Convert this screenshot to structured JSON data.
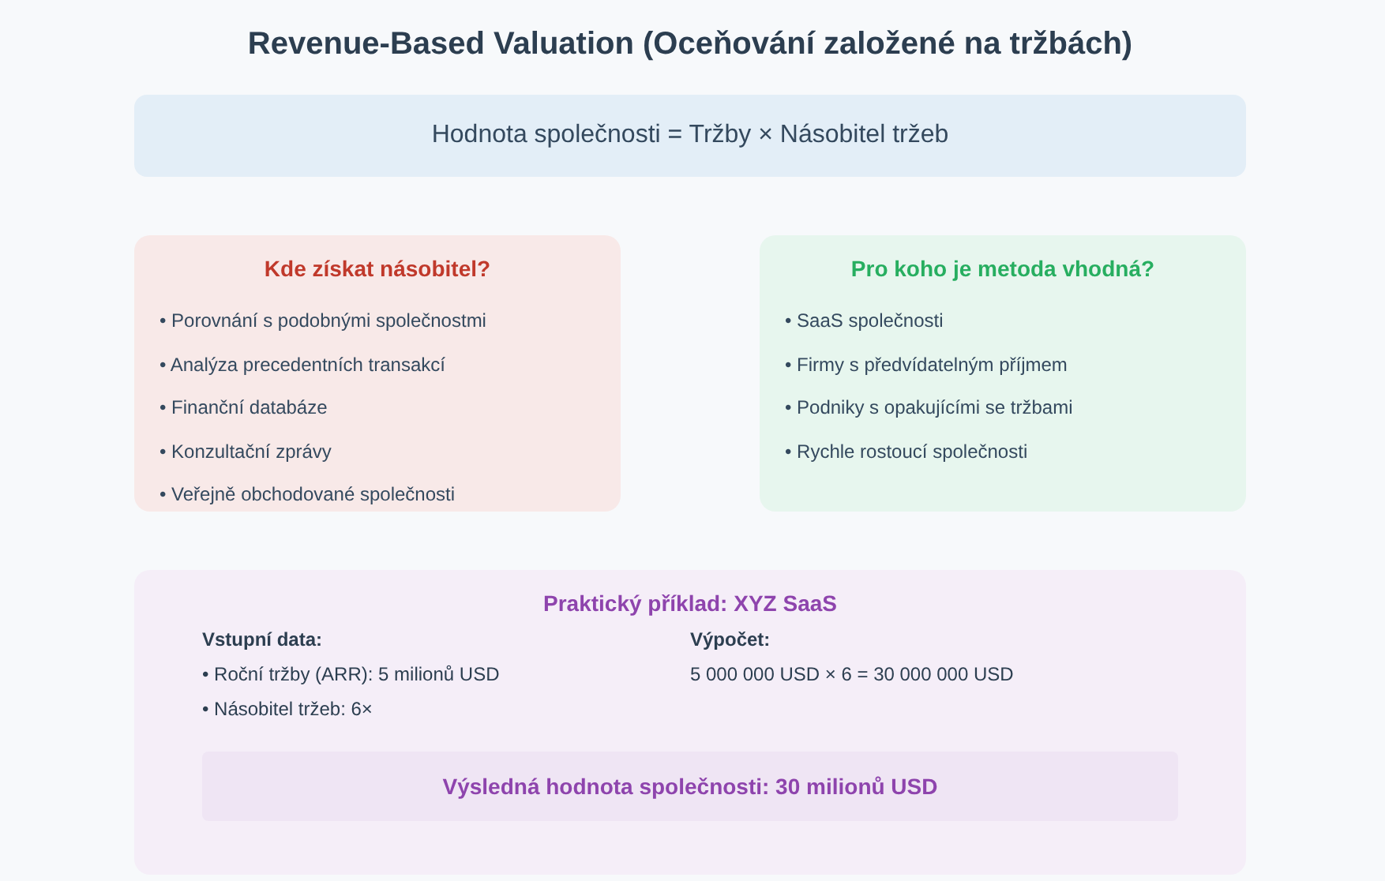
{
  "title": "Revenue-Based Valuation (Oceňování založené na tržbách)",
  "formula": "Hodnota společnosti = Tržby × Násobitel tržeb",
  "cards": [
    {
      "title": "Kde získat násobitel?",
      "color": "#c0392b",
      "items": [
        "• Porovnání s podobnými společnostmi",
        "• Analýza precedentních transakcí",
        "• Finanční databáze",
        "• Konzultační zprávy",
        "• Veřejně obchodované společnosti"
      ]
    },
    {
      "title": "Pro koho je metoda vhodná?",
      "color": "#27ae60",
      "items": [
        "• SaaS společnosti",
        "• Firmy s předvídatelným příjmem",
        "• Podniky s opakujícími se tržbami",
        "• Rychle rostoucí společnosti"
      ]
    }
  ],
  "example": {
    "title": "Praktický příklad: XYZ SaaS",
    "color": "#8e44ad",
    "input": {
      "heading": "Vstupní data:",
      "items": [
        "• Roční tržby (ARR): 5 milionů USD",
        "• Násobitel tržeb: 6×"
      ]
    },
    "calculation": {
      "heading": "Výpočet:",
      "text": "5 000 000 USD × 6 = 30 000 000 USD"
    },
    "result": "Výsledná hodnota společnosti: 30 milionů USD"
  }
}
